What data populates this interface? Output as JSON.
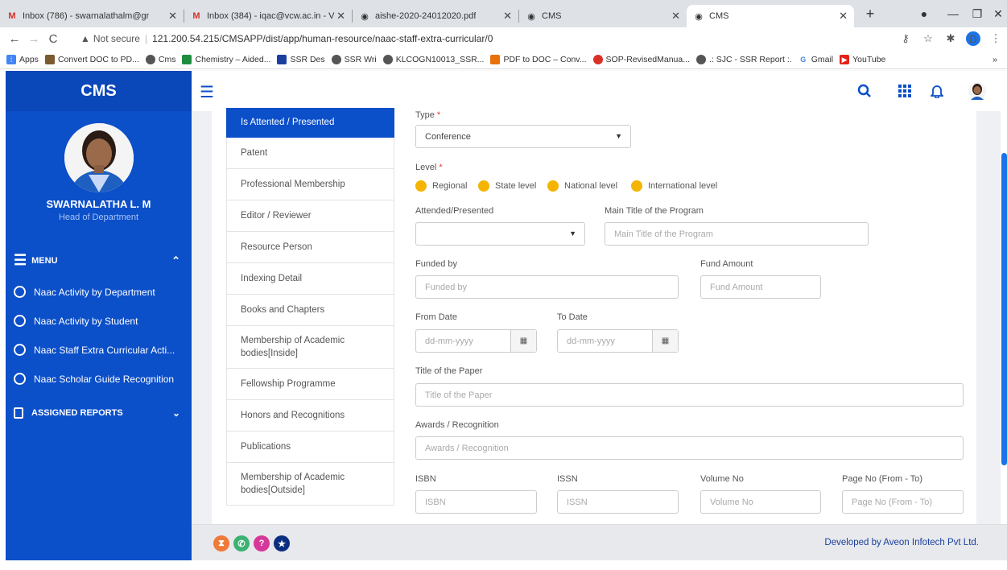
{
  "browser": {
    "tabs": [
      {
        "title": "Inbox (786) - swarnalathalm@gr",
        "icon": "gmail-icon"
      },
      {
        "title": "Inbox (384) - iqac@vcw.ac.in - V",
        "icon": "gmail-icon"
      },
      {
        "title": "aishe-2020-24012020.pdf",
        "icon": "globe-icon"
      },
      {
        "title": "CMS",
        "icon": "globe-icon"
      },
      {
        "title": "CMS",
        "icon": "globe-icon",
        "active": true
      }
    ],
    "security": "Not secure",
    "url": "121.200.54.215/CMSAPP/dist/app/human-resource/naac-staff-extra-curricular/0",
    "profile_initial": "D",
    "bookmarks": [
      "Apps",
      "Convert DOC to PD...",
      "Cms",
      "Chemistry – Aided...",
      "SSR Des",
      "SSR Wri",
      "KLCOGN10013_SSR...",
      "PDF to DOC – Conv...",
      "SOP-RevisedManua...",
      ".: SJC - SSR Report :.",
      "Gmail",
      "YouTube"
    ],
    "more_bookmarks": "»"
  },
  "sidebar": {
    "logo": "CMS",
    "user_name": "SWARNALATHA L. M",
    "user_role": "Head of Department",
    "menu_label": "MENU",
    "items": [
      "Naac Activity by Department",
      "Naac Activity by Student",
      "Naac Staff Extra Curricular Acti...",
      "Naac Scholar Guide Recognition"
    ],
    "assigned_reports": "ASSIGNED REPORTS"
  },
  "leftnav": [
    "Is Attented / Presented",
    "Patent",
    "Professional Membership",
    "Editor / Reviewer",
    "Resource Person",
    "Indexing Detail",
    "Books and Chapters",
    "Membership of Academic bodies[Inside]",
    "Fellowship Programme",
    "Honors and Recognitions",
    "Publications",
    "Membership of Academic bodies[Outside]"
  ],
  "form": {
    "type_label": "Type",
    "type_value": "Conference",
    "level_label": "Level",
    "levels": [
      "Regional",
      "State level",
      "National level",
      "International level"
    ],
    "attended_label": "Attended/Presented",
    "attended_value": "",
    "main_title_label": "Main Title of the Program",
    "main_title_ph": "Main Title of the Program",
    "funded_by_label": "Funded by",
    "funded_by_ph": "Funded by",
    "fund_amount_label": "Fund Amount",
    "fund_amount_ph": "Fund Amount",
    "from_date_label": "From Date",
    "to_date_label": "To Date",
    "date_ph": "dd-mm-yyyy",
    "paper_label": "Title of the Paper",
    "paper_ph": "Title of the Paper",
    "awards_label": "Awards / Recognition",
    "awards_ph": "Awards / Recognition",
    "isbn_label": "ISBN",
    "isbn_ph": "ISBN",
    "issn_label": "ISSN",
    "issn_ph": "ISSN",
    "volume_label": "Volume No",
    "volume_ph": "Volume No",
    "page_label": "Page No (From - To)",
    "page_ph": "Page No (From - To)"
  },
  "footer": {
    "developer": "Developed by Aveon Infotech Pvt Ltd."
  },
  "colors": {
    "primary": "#0b4fc9",
    "radio": "#f4b400"
  }
}
